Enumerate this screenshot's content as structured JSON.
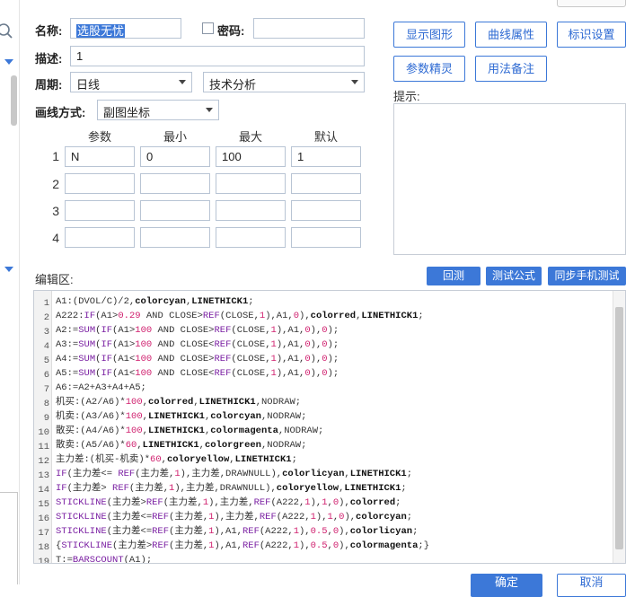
{
  "form": {
    "name_label": "名称:",
    "name_value": "选股无忧",
    "password_label": "密码:",
    "desc_label": "描述:",
    "desc_value": "1",
    "period_label": "周期:",
    "period_value": "日线",
    "type_value": "技术分析",
    "draw_label": "画线方式:",
    "draw_value": "副图坐标",
    "hint_label": "提示:",
    "editor_label": "编辑区:"
  },
  "buttons": {
    "show_graph": "显示图形",
    "curve_props": "曲线属性",
    "mark_settings": "标识设置",
    "param_wizard": "参数精灵",
    "usage_notes": "用法备注",
    "backtest": "回测",
    "test_formula": "测试公式",
    "sync_mobile": "同步手机测试",
    "ok": "确定",
    "cancel": "取消"
  },
  "params": {
    "headers": [
      "参数",
      "最小",
      "最大",
      "默认"
    ],
    "rows": [
      {
        "num": "1",
        "name": "N",
        "min": "0",
        "max": "100",
        "def": "1"
      },
      {
        "num": "2",
        "name": "",
        "min": "",
        "max": "",
        "def": ""
      },
      {
        "num": "3",
        "name": "",
        "min": "",
        "max": "",
        "def": ""
      },
      {
        "num": "4",
        "name": "",
        "min": "",
        "max": "",
        "def": ""
      }
    ]
  },
  "colors": {
    "accent": "#3c78d8",
    "keyword": "#7a1fa2",
    "number": "#d0216f",
    "bold": "#111111"
  },
  "code_lines": [
    [
      {
        "t": "A1:(DVOL/C)/2,"
      },
      {
        "t": "colorcyan",
        "b": 1
      },
      {
        "t": ","
      },
      {
        "t": "LINETHICK1",
        "b": 1
      },
      {
        "t": ";"
      }
    ],
    [
      {
        "t": "A222:"
      },
      {
        "t": "IF",
        "k": 1
      },
      {
        "t": "(A1>"
      },
      {
        "t": "0.29",
        "n": 1
      },
      {
        "t": " AND CLOSE>"
      },
      {
        "t": "REF",
        "k": 1
      },
      {
        "t": "(CLOSE,"
      },
      {
        "t": "1",
        "n": 1
      },
      {
        "t": "),A1,"
      },
      {
        "t": "0",
        "n": 1
      },
      {
        "t": "),"
      },
      {
        "t": "colorred",
        "b": 1
      },
      {
        "t": ","
      },
      {
        "t": "LINETHICK1",
        "b": 1
      },
      {
        "t": ";"
      }
    ],
    [
      {
        "t": "A2:="
      },
      {
        "t": "SUM",
        "k": 1
      },
      {
        "t": "("
      },
      {
        "t": "IF",
        "k": 1
      },
      {
        "t": "(A1>"
      },
      {
        "t": "100",
        "n": 1
      },
      {
        "t": " AND CLOSE>"
      },
      {
        "t": "REF",
        "k": 1
      },
      {
        "t": "(CLOSE,"
      },
      {
        "t": "1",
        "n": 1
      },
      {
        "t": "),A1,"
      },
      {
        "t": "0",
        "n": 1
      },
      {
        "t": "),"
      },
      {
        "t": "0",
        "n": 1
      },
      {
        "t": ");"
      }
    ],
    [
      {
        "t": "A3:="
      },
      {
        "t": "SUM",
        "k": 1
      },
      {
        "t": "("
      },
      {
        "t": "IF",
        "k": 1
      },
      {
        "t": "(A1>"
      },
      {
        "t": "100",
        "n": 1
      },
      {
        "t": " AND CLOSE<"
      },
      {
        "t": "REF",
        "k": 1
      },
      {
        "t": "(CLOSE,"
      },
      {
        "t": "1",
        "n": 1
      },
      {
        "t": "),A1,"
      },
      {
        "t": "0",
        "n": 1
      },
      {
        "t": "),"
      },
      {
        "t": "0",
        "n": 1
      },
      {
        "t": ");"
      }
    ],
    [
      {
        "t": "A4:="
      },
      {
        "t": "SUM",
        "k": 1
      },
      {
        "t": "("
      },
      {
        "t": "IF",
        "k": 1
      },
      {
        "t": "(A1<"
      },
      {
        "t": "100",
        "n": 1
      },
      {
        "t": " AND CLOSE>"
      },
      {
        "t": "REF",
        "k": 1
      },
      {
        "t": "(CLOSE,"
      },
      {
        "t": "1",
        "n": 1
      },
      {
        "t": "),A1,"
      },
      {
        "t": "0",
        "n": 1
      },
      {
        "t": "),"
      },
      {
        "t": "0",
        "n": 1
      },
      {
        "t": ");"
      }
    ],
    [
      {
        "t": "A5:="
      },
      {
        "t": "SUM",
        "k": 1
      },
      {
        "t": "("
      },
      {
        "t": "IF",
        "k": 1
      },
      {
        "t": "(A1<"
      },
      {
        "t": "100",
        "n": 1
      },
      {
        "t": " AND CLOSE<"
      },
      {
        "t": "REF",
        "k": 1
      },
      {
        "t": "(CLOSE,"
      },
      {
        "t": "1",
        "n": 1
      },
      {
        "t": "),A1,"
      },
      {
        "t": "0",
        "n": 1
      },
      {
        "t": "),"
      },
      {
        "t": "0",
        "n": 1
      },
      {
        "t": ");"
      }
    ],
    [
      {
        "t": "A6:=A2+A3+A4+A5;"
      }
    ],
    [
      {
        "t": "机买:(A2/A6)*"
      },
      {
        "t": "100",
        "n": 1
      },
      {
        "t": ","
      },
      {
        "t": "colorred",
        "b": 1
      },
      {
        "t": ","
      },
      {
        "t": "LINETHICK1",
        "b": 1
      },
      {
        "t": ",NODRAW;"
      }
    ],
    [
      {
        "t": "机卖:(A3/A6)*"
      },
      {
        "t": "100",
        "n": 1
      },
      {
        "t": ","
      },
      {
        "t": "LINETHICK1",
        "b": 1
      },
      {
        "t": ","
      },
      {
        "t": "colorcyan",
        "b": 1
      },
      {
        "t": ",NODRAW;"
      }
    ],
    [
      {
        "t": "散买:(A4/A6)*"
      },
      {
        "t": "100",
        "n": 1
      },
      {
        "t": ","
      },
      {
        "t": "LINETHICK1",
        "b": 1
      },
      {
        "t": ","
      },
      {
        "t": "colormagenta",
        "b": 1
      },
      {
        "t": ",NODRAW;"
      }
    ],
    [
      {
        "t": "散卖:(A5/A6)*"
      },
      {
        "t": "60",
        "n": 1
      },
      {
        "t": ","
      },
      {
        "t": "LINETHICK1",
        "b": 1
      },
      {
        "t": ","
      },
      {
        "t": "colorgreen",
        "b": 1
      },
      {
        "t": ",NODRAW;"
      }
    ],
    [
      {
        "t": "主力差:(机买-机卖)*"
      },
      {
        "t": "60",
        "n": 1
      },
      {
        "t": ","
      },
      {
        "t": "coloryellow",
        "b": 1
      },
      {
        "t": ","
      },
      {
        "t": "LINETHICK1",
        "b": 1
      },
      {
        "t": ";"
      }
    ],
    [
      {
        "t": "IF",
        "k": 1
      },
      {
        "t": "(主力差<= "
      },
      {
        "t": "REF",
        "k": 1
      },
      {
        "t": "(主力差,"
      },
      {
        "t": "1",
        "n": 1
      },
      {
        "t": "),主力差,DRAWNULL),"
      },
      {
        "t": "colorlicyan",
        "b": 1
      },
      {
        "t": ","
      },
      {
        "t": "LINETHICK1",
        "b": 1
      },
      {
        "t": ";"
      }
    ],
    [
      {
        "t": "IF",
        "k": 1
      },
      {
        "t": "(主力差> "
      },
      {
        "t": "REF",
        "k": 1
      },
      {
        "t": "(主力差,"
      },
      {
        "t": "1",
        "n": 1
      },
      {
        "t": "),主力差,DRAWNULL),"
      },
      {
        "t": "coloryellow",
        "b": 1
      },
      {
        "t": ","
      },
      {
        "t": "LINETHICK1",
        "b": 1
      },
      {
        "t": ";"
      }
    ],
    [
      {
        "t": "STICKLINE",
        "k": 1
      },
      {
        "t": "(主力差>"
      },
      {
        "t": "REF",
        "k": 1
      },
      {
        "t": "(主力差,"
      },
      {
        "t": "1",
        "n": 1
      },
      {
        "t": "),主力差,"
      },
      {
        "t": "REF",
        "k": 1
      },
      {
        "t": "(A222,"
      },
      {
        "t": "1",
        "n": 1
      },
      {
        "t": "),"
      },
      {
        "t": "1",
        "n": 1
      },
      {
        "t": ","
      },
      {
        "t": "0",
        "n": 1
      },
      {
        "t": "),"
      },
      {
        "t": "colorred",
        "b": 1
      },
      {
        "t": ";"
      }
    ],
    [
      {
        "t": "STICKLINE",
        "k": 1
      },
      {
        "t": "(主力差<="
      },
      {
        "t": "REF",
        "k": 1
      },
      {
        "t": "(主力差,"
      },
      {
        "t": "1",
        "n": 1
      },
      {
        "t": "),主力差,"
      },
      {
        "t": "REF",
        "k": 1
      },
      {
        "t": "(A222,"
      },
      {
        "t": "1",
        "n": 1
      },
      {
        "t": "),"
      },
      {
        "t": "1",
        "n": 1
      },
      {
        "t": ","
      },
      {
        "t": "0",
        "n": 1
      },
      {
        "t": "),"
      },
      {
        "t": "colorcyan",
        "b": 1
      },
      {
        "t": ";"
      }
    ],
    [
      {
        "t": "STICKLINE",
        "k": 1
      },
      {
        "t": "(主力差<="
      },
      {
        "t": "REF",
        "k": 1
      },
      {
        "t": "(主力差,"
      },
      {
        "t": "1",
        "n": 1
      },
      {
        "t": "),A1,"
      },
      {
        "t": "REF",
        "k": 1
      },
      {
        "t": "(A222,"
      },
      {
        "t": "1",
        "n": 1
      },
      {
        "t": "),"
      },
      {
        "t": "0.5",
        "n": 1
      },
      {
        "t": ","
      },
      {
        "t": "0",
        "n": 1
      },
      {
        "t": "),"
      },
      {
        "t": "colorlicyan",
        "b": 1
      },
      {
        "t": ";"
      }
    ],
    [
      {
        "t": "{"
      },
      {
        "t": "STICKLINE",
        "k": 1
      },
      {
        "t": "(主力差>"
      },
      {
        "t": "REF",
        "k": 1
      },
      {
        "t": "(主力差,"
      },
      {
        "t": "1",
        "n": 1
      },
      {
        "t": "),A1,"
      },
      {
        "t": "REF",
        "k": 1
      },
      {
        "t": "(A222,"
      },
      {
        "t": "1",
        "n": 1
      },
      {
        "t": "),"
      },
      {
        "t": "0.5",
        "n": 1
      },
      {
        "t": ","
      },
      {
        "t": "0",
        "n": 1
      },
      {
        "t": "),"
      },
      {
        "t": "colormagenta",
        "b": 1
      },
      {
        "t": ";}"
      }
    ],
    [
      {
        "t": "T:="
      },
      {
        "t": "BARSCOUNT",
        "k": 1
      },
      {
        "t": "(A1);"
      }
    ]
  ]
}
